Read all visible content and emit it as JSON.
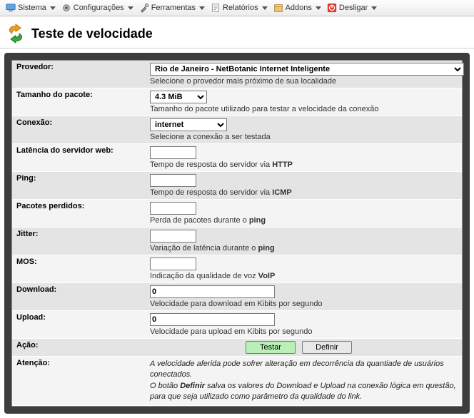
{
  "menubar": {
    "items": [
      {
        "label": "Sistema",
        "icon": "monitor-icon"
      },
      {
        "label": "Configurações",
        "icon": "gear-icon"
      },
      {
        "label": "Ferramentas",
        "icon": "tools-icon"
      },
      {
        "label": "Relatórios",
        "icon": "report-icon"
      },
      {
        "label": "Addons",
        "icon": "package-icon"
      },
      {
        "label": "Desligar",
        "icon": "power-icon"
      }
    ]
  },
  "page_title": "Teste de velocidade",
  "form": {
    "provedor": {
      "label": "Provedor:",
      "value": "Rio de Janeiro - NetBotanic Internet Inteligente",
      "hint": "Selecione o provedor mais próximo de sua localidade"
    },
    "pacote": {
      "label": "Tamanho do pacote:",
      "value": "4.3 MiB",
      "hint": "Tamanho do pacote utilizado para testar a velocidade da conexão"
    },
    "conexao": {
      "label": "Conexão:",
      "value": "internet",
      "hint": "Selecione a conexão a ser testada"
    },
    "latencia": {
      "label": "Latência do servidor web:",
      "value": "",
      "hint_pre": "Tempo de resposta do servidor via ",
      "hint_b": "HTTP"
    },
    "ping": {
      "label": "Ping:",
      "value": "",
      "hint_pre": "Tempo de resposta do servidor via ",
      "hint_b": "ICMP"
    },
    "perdidos": {
      "label": "Pacotes perdidos:",
      "value": "",
      "hint_pre": "Perda de pacotes durante o ",
      "hint_b": "ping"
    },
    "jitter": {
      "label": "Jitter:",
      "value": "",
      "hint_pre": "Variação de latência durante o ",
      "hint_b": "ping"
    },
    "mos": {
      "label": "MOS:",
      "value": "",
      "hint_pre": "Indicação da qualidade de voz ",
      "hint_b": "VoIP"
    },
    "download": {
      "label": "Download:",
      "value": "0",
      "hint": "Velocidade para download em Kibits por segundo"
    },
    "upload": {
      "label": "Upload:",
      "value": "0",
      "hint": "Velocidade para upload em Kibits por segundo"
    },
    "acao": {
      "label": "Ação:",
      "btn_test": "Testar",
      "btn_define": "Definir"
    },
    "atencao": {
      "label": "Atenção:",
      "line1": "A velocidade aferida pode sofrer alteração em decorrência da quantiade de usuários conectados.",
      "line2a": "O botão ",
      "line2b": "Definir",
      "line2c": " salva os valores do Download e Upload na conexão lógica em questão,",
      "line3": "para que seja utilizado como parâmetro da qualidade do link."
    }
  }
}
